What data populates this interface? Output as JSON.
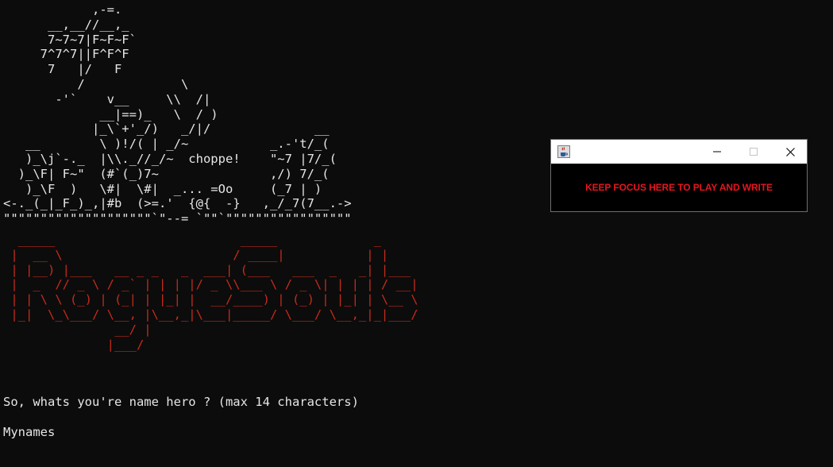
{
  "console": {
    "ascii_art": "            ,-=.\n      __,__//__,_\n      7~7~7|F~F~F`\n     7^7^7||F^F^F\n      7   |/   F\n          /             \\\n       -'`    v__     \\\\  /|\n             __|==)_   \\  / )\n            |_\\`+'_/)   _/|/              __\n   __        \\ )!/( | _/~           _.-'t/_(\n   )_\\j`-._  |\\\\._//_/~  choppe!    \"~7 |7/_(\n  )_\\F| F~\"  (#`(_)7~               ,/) 7/_(\n   )_\\F  )   \\#|  \\#|  _... =Oo     (_7 | )\n<-._(_|_F_)_,|#b  (>=.'  {@{  -}   ,_/_7(7__.->\n\"\"\"\"\"\"\"\"\"\"\"\"\"\"\"\"\"\"\"\"`\"--= `\"\"`\"\"\"\"\"\"\"\"\"\"\"\"\"\"\"\"\"",
    "title_art": "  _____                         _____             _\n |  __ \\                       / ____|           | |\n | |__) |___   __ _ _   _  ___| (___   ___  _   _| |___\n |  _  // _ \\ / _` | | | |/ _ \\\\___ \\ / _ \\| | | | / __|\n | | \\ \\ (_) | (_| | |_| |  __/____) | (_) | |_| | \\__ \\\n |_|  \\_\\___/ \\__, |\\__,_|\\___|_____/ \\___/ \\__,_|_|___/\n               __/ |\n              |___/",
    "prompt": "So, whats you're name hero ? (max 14 characters)",
    "answer": "Mynames"
  },
  "window": {
    "icon": "java-cup-icon",
    "message": "KEEP FOCUS HERE TO PLAY AND WRITE",
    "message_color": "#e8141e",
    "controls": [
      "minimize-icon",
      "maximize-icon",
      "close-icon"
    ]
  }
}
